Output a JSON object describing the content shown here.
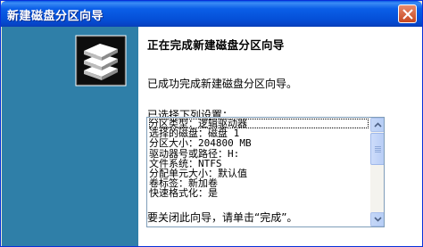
{
  "window": {
    "title": "新建磁盘分区向导"
  },
  "content": {
    "heading": "正在完成新建磁盘分区向导",
    "success_message": "已成功完成新建磁盘分区向导。",
    "settings_label": "已选择下列设置：",
    "settings": [
      "分区类型：逻辑驱动器",
      "选择的磁盘：磁盘 1",
      "分区大小：204800 MB",
      "驱动器号或路径：H:",
      "文件系统：NTFS",
      "分配单元大小：默认值",
      "卷标签：新加卷",
      "快速格式化：是"
    ],
    "close_hint": "要关闭此向导，请单击“完成”。"
  },
  "colors": {
    "sidebar": "#2f7fa8",
    "titlebar": "#0550d8"
  },
  "icons": {
    "close": "close-icon",
    "wizard": "disk-stack-icon"
  }
}
